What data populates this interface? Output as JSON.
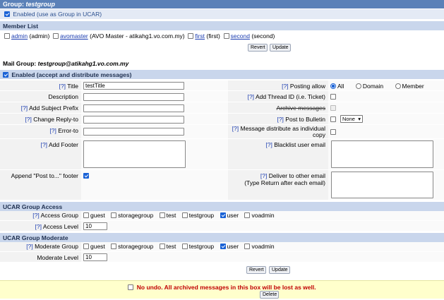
{
  "group": {
    "label": "Group:",
    "name": "testgroup"
  },
  "enabled_ucar": "Enabled (use as Group in UCAR)",
  "member_list": {
    "title": "Member List",
    "members": [
      {
        "link": "admin",
        "text": "(admin)"
      },
      {
        "link": "avomaster",
        "text": "(AVO Master - atikahg1.vo.com.my)"
      },
      {
        "link": "first",
        "text": "(first)"
      },
      {
        "link": "second",
        "text": "(second)"
      }
    ],
    "revert": "Revert",
    "update": "Update"
  },
  "mail_group": {
    "label": "Mail Group:",
    "address": "testgroup@atikahg1.vo.com.my"
  },
  "enabled_mail": "Enabled (accept and distribute messages)",
  "help": "[?]",
  "fields": {
    "title": {
      "label": "Title",
      "value": "testTitle"
    },
    "description": "Description",
    "add_subject_prefix": "Add Subject Prefix",
    "change_reply_to": "Change Reply-to",
    "error_to": "Error-to",
    "add_footer": "Add Footer",
    "append_post_to": "Append \"Post to...\" footer",
    "posting_allow": {
      "label": "Posting allow",
      "options": [
        "All",
        "Domain",
        "Member"
      ],
      "selected": "All"
    },
    "add_thread_id": "Add Thread ID (i.e. Ticket)",
    "archive_messages": "Archive messages",
    "post_to_bulletin": {
      "label": "Post to Bulletin",
      "select": "None"
    },
    "msg_individual_line1": "Message distribute as individual",
    "msg_individual_line2": "copy",
    "blacklist": "Blacklist user email",
    "deliver_other_line1": "Deliver to other email",
    "deliver_other_line2": "(Type Return after each email)"
  },
  "access": {
    "title": "UCAR Group Access",
    "group_label": "Access Group",
    "level_label": "Access Level",
    "level_value": "10",
    "options": [
      "guest",
      "storagegroup",
      "test",
      "testgroup",
      "user",
      "voadmin"
    ],
    "checked": [
      "user"
    ]
  },
  "moderate": {
    "title": "UCAR Group Moderate",
    "group_label": "Moderate Group",
    "level_label": "Moderate Level",
    "level_value": "10",
    "options": [
      "guest",
      "storagegroup",
      "test",
      "testgroup",
      "user",
      "voadmin"
    ],
    "checked": [
      "user"
    ]
  },
  "bottom": {
    "revert": "Revert",
    "update": "Update"
  },
  "undo": {
    "message": "No undo. All archived messages in this box will be lost as well.",
    "delete": "Delete"
  }
}
